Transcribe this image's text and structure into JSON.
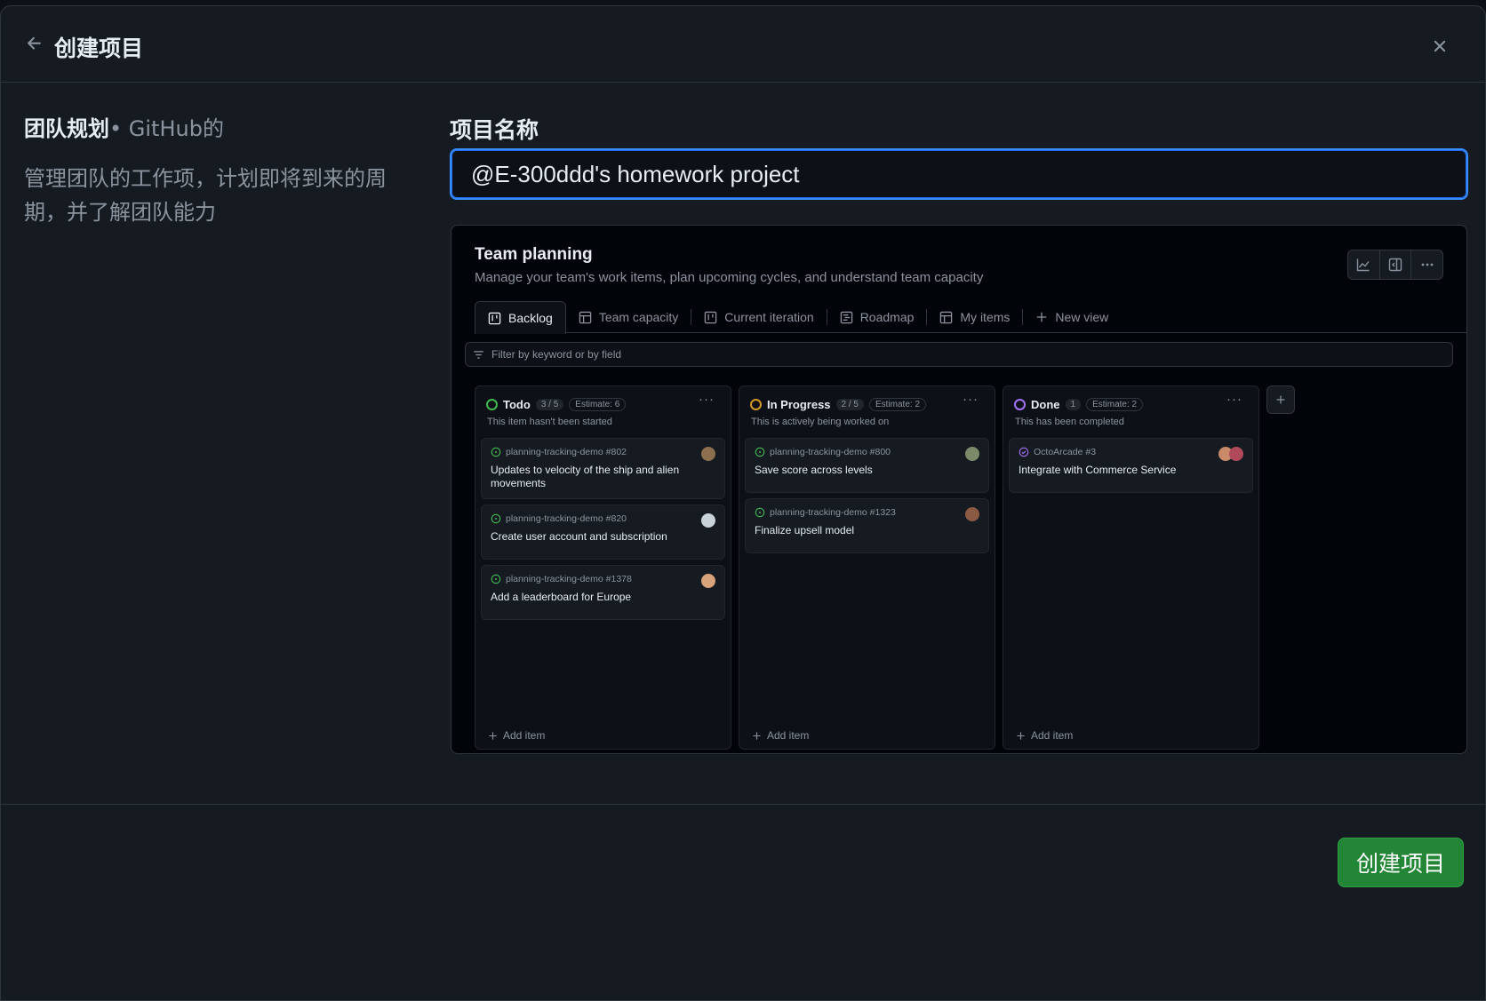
{
  "dialog": {
    "title": "创建项目",
    "create_label": "创建项目"
  },
  "template": {
    "name": "团队规划",
    "owner": "• GitHub的",
    "description": "管理团队的工作项，计划即将到来的周期，并了解团队能力"
  },
  "form": {
    "label": "项目名称",
    "value": "@E-300ddd's homework project"
  },
  "preview": {
    "title": "Team planning",
    "subtitle": "Manage your team's work items, plan upcoming cycles, and understand team capacity",
    "tabs": [
      {
        "label": "Backlog",
        "icon": "board-icon"
      },
      {
        "label": "Team capacity",
        "icon": "table-icon"
      },
      {
        "label": "Current iteration",
        "icon": "board-icon"
      },
      {
        "label": "Roadmap",
        "icon": "roadmap-icon"
      },
      {
        "label": "My items",
        "icon": "table-icon"
      },
      {
        "label": "New view",
        "icon": "plus-icon"
      }
    ],
    "filter_placeholder": "Filter by keyword or by field",
    "add_item_label": "Add item",
    "columns": [
      {
        "name": "Todo",
        "count": "3 / 5",
        "estimate": "Estimate: 6",
        "description": "This item hasn't been started",
        "color": "#3fb950",
        "cards": [
          {
            "repo": "planning-tracking-demo #802",
            "title": "Updates to velocity of the ship and alien movements"
          },
          {
            "repo": "planning-tracking-demo #820",
            "title": "Create user account and subscription"
          },
          {
            "repo": "planning-tracking-demo #1378",
            "title": "Add a leaderboard for Europe"
          }
        ]
      },
      {
        "name": "In Progress",
        "count": "2 / 5",
        "estimate": "Estimate: 2",
        "description": "This is actively being worked on",
        "color": "#d29922",
        "cards": [
          {
            "repo": "planning-tracking-demo #800",
            "title": "Save score across levels"
          },
          {
            "repo": "planning-tracking-demo #1323",
            "title": "Finalize upsell model"
          }
        ]
      },
      {
        "name": "Done",
        "count": "1",
        "estimate": "Estimate: 2",
        "description": "This has been completed",
        "color": "#a371f7",
        "cards": [
          {
            "repo": "OctoArcade #3",
            "title": "Integrate with Commerce Service"
          }
        ]
      }
    ]
  },
  "colors": {
    "accent": "#388bfd",
    "primary_button": "#238636"
  }
}
